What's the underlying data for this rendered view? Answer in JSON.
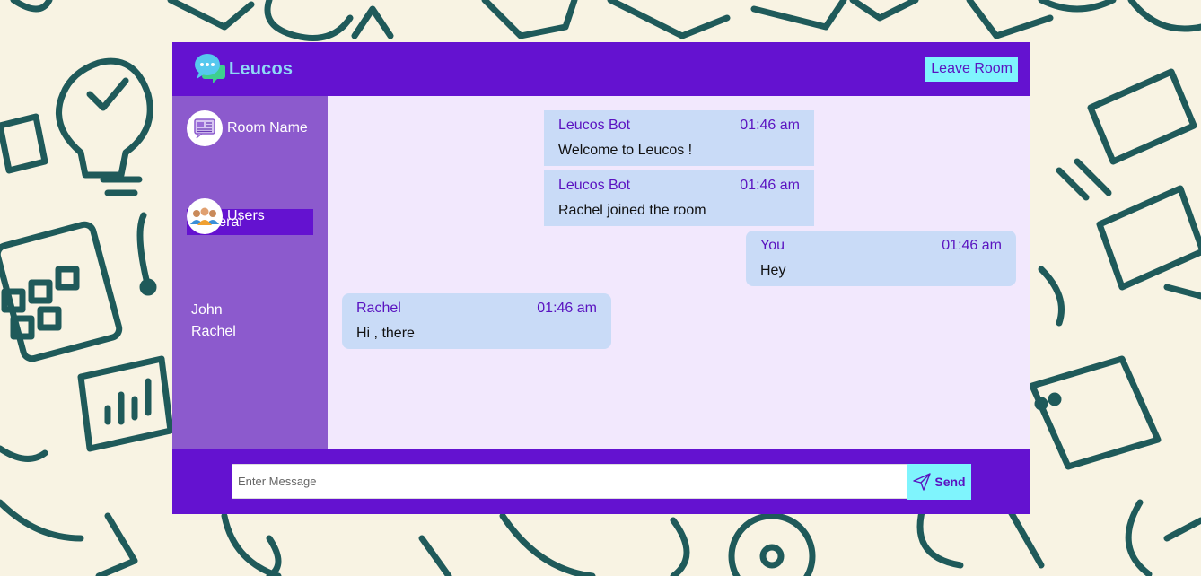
{
  "header": {
    "brand": "Leucos",
    "logo_icon": "chat-bubbles-icon",
    "leave_label": "Leave Room"
  },
  "sidebar": {
    "room_heading": "Room Name",
    "room_icon": "chat-room-icon",
    "room_name": "General",
    "users_heading": "Users",
    "users_icon": "users-group-icon",
    "users": [
      "John",
      "Rachel"
    ]
  },
  "messages": [
    {
      "author": "Leucos Bot",
      "time": "01:46 am",
      "text": "Welcome to Leucos !"
    },
    {
      "author": "Leucos Bot",
      "time": "01:46 am",
      "text": "Rachel joined the room"
    },
    {
      "author": "You",
      "time": "01:46 am",
      "text": "Hey"
    },
    {
      "author": "Rachel",
      "time": "01:46 am",
      "text": "Hi , there"
    }
  ],
  "composer": {
    "placeholder": "Enter Message",
    "value": "",
    "send_label": "Send",
    "send_icon": "paper-plane-icon"
  },
  "colors": {
    "primary": "#6412d0",
    "sidebar": "#8c5acd",
    "chat_bg": "#f2e8fd",
    "bubble": "#c9dbf7",
    "accent": "#7ff4fd",
    "page_bg": "#f8f3e3",
    "doodle": "#1f5a5a"
  }
}
